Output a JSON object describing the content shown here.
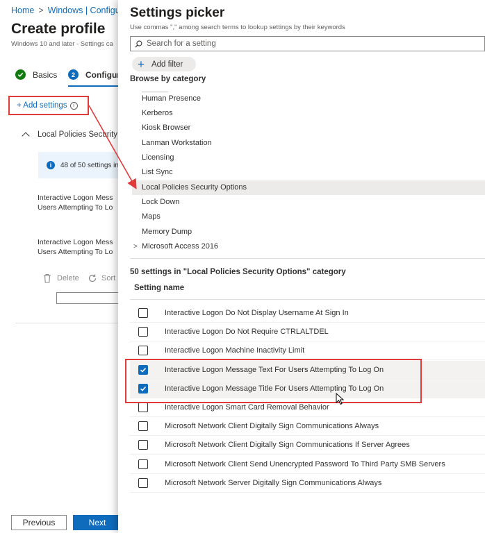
{
  "breadcrumb": {
    "home": "Home",
    "current": "Windows | Configur"
  },
  "page": {
    "title": "Create profile",
    "subtitle": "Windows 10 and later - Settings ca"
  },
  "steps": [
    {
      "number": "",
      "label": "Basics"
    },
    {
      "number": "2",
      "label": "Configur"
    }
  ],
  "add_settings": {
    "label": "+ Add settings",
    "info_glyph": "i"
  },
  "accordion": {
    "label": "Local Policies Security O"
  },
  "info_banner": {
    "glyph": "i",
    "text": "48 of 50 settings in"
  },
  "setting_labels": [
    {
      "line1": "Interactive Logon Mess",
      "line2": "Users Attempting To Lo"
    },
    {
      "line1": "Interactive Logon Mess",
      "line2": "Users Attempting To Lo"
    }
  ],
  "actions": {
    "delete": "Delete",
    "sort": "Sort"
  },
  "footer": {
    "previous": "Previous",
    "next": "Next"
  },
  "picker": {
    "title": "Settings picker",
    "hint": "Use commas \",\" among search terms to lookup settings by their keywords",
    "search_placeholder": "Search for a setting",
    "add_filter": "Add filter",
    "browse_label": "Browse by category",
    "categories": [
      {
        "label": "Human Presence",
        "selected": false,
        "expander": ""
      },
      {
        "label": "Kerberos",
        "selected": false,
        "expander": ""
      },
      {
        "label": "Kiosk Browser",
        "selected": false,
        "expander": ""
      },
      {
        "label": "Lanman Workstation",
        "selected": false,
        "expander": ""
      },
      {
        "label": "Licensing",
        "selected": false,
        "expander": ""
      },
      {
        "label": "List Sync",
        "selected": false,
        "expander": ""
      },
      {
        "label": "Local Policies Security Options",
        "selected": true,
        "expander": ""
      },
      {
        "label": "Lock Down",
        "selected": false,
        "expander": ""
      },
      {
        "label": "Maps",
        "selected": false,
        "expander": ""
      },
      {
        "label": "Memory Dump",
        "selected": false,
        "expander": ""
      },
      {
        "label": "Microsoft Access 2016",
        "selected": false,
        "expander": ">"
      }
    ],
    "settings_count": "50 settings in \"Local Policies Security Options\" category",
    "column_header": "Setting name",
    "settings": [
      {
        "name": "Interactive Logon Do Not Display Username At Sign In",
        "checked": false
      },
      {
        "name": "Interactive Logon Do Not Require CTRLALTDEL",
        "checked": false
      },
      {
        "name": "Interactive Logon Machine Inactivity Limit",
        "checked": false
      },
      {
        "name": "Interactive Logon Message Text For Users Attempting To Log On",
        "checked": true
      },
      {
        "name": "Interactive Logon Message Title For Users Attempting To Log On",
        "checked": true
      },
      {
        "name": "Interactive Logon Smart Card Removal Behavior",
        "checked": false
      },
      {
        "name": "Microsoft Network Client Digitally Sign Communications Always",
        "checked": false
      },
      {
        "name": "Microsoft Network Client Digitally Sign Communications If Server Agrees",
        "checked": false
      },
      {
        "name": "Microsoft Network Client Send Unencrypted Password To Third Party SMB Servers",
        "checked": false
      },
      {
        "name": "Microsoft Network Server Digitally Sign Communications Always",
        "checked": false
      }
    ]
  },
  "colors": {
    "accent": "#0f6cbd",
    "success": "#107c10",
    "annotation": "#e03a3a",
    "selected_row": "#edebe9"
  }
}
